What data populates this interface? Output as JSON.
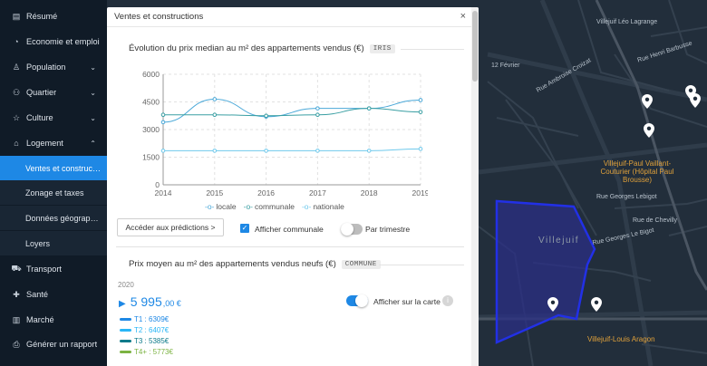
{
  "sidebar": {
    "items": [
      {
        "label": "Résumé",
        "icon": "document-icon",
        "glyph": "▤",
        "chevron": ""
      },
      {
        "label": "Economie et emploi",
        "icon": "pie-chart-icon",
        "glyph": "◔",
        "chevron": ""
      },
      {
        "label": "Population",
        "icon": "user-icon",
        "glyph": "♙",
        "chevron": "⌄"
      },
      {
        "label": "Quartier",
        "icon": "people-icon",
        "glyph": "⚇",
        "chevron": "⌄"
      },
      {
        "label": "Culture",
        "icon": "star-icon",
        "glyph": "☆",
        "chevron": "⌄"
      },
      {
        "label": "Logement",
        "icon": "home-icon",
        "glyph": "⌂",
        "chevron": "⌃"
      },
      {
        "label": "Transport",
        "icon": "car-icon",
        "glyph": "⛟",
        "chevron": ""
      },
      {
        "label": "Santé",
        "icon": "medical-icon",
        "glyph": "✚",
        "chevron": ""
      },
      {
        "label": "Marché",
        "icon": "bar-chart-icon",
        "glyph": "▥",
        "chevron": ""
      },
      {
        "label": "Générer un rapport",
        "icon": "printer-icon",
        "glyph": "⎙",
        "chevron": ""
      }
    ],
    "sub_items": [
      {
        "label": "Ventes et constructions",
        "active": true
      },
      {
        "label": "Zonage et taxes",
        "active": false
      },
      {
        "label": "Données géographiques",
        "active": false
      },
      {
        "label": "Loyers",
        "active": false
      }
    ]
  },
  "modal": {
    "title": "Ventes et constructions",
    "close": "×",
    "section1": {
      "title": "Évolution du prix median au m² des appartements vendus (€)",
      "tag": "IRIS"
    },
    "legend": [
      "locale",
      "communale",
      "nationale"
    ],
    "predictions_button": "Accéder aux prédictions  >",
    "checkbox_label": "Afficher communale",
    "checkbox_mark": "✓",
    "toggle_label": "Par trimestre",
    "section2": {
      "title": "Prix moyen au m² des appartements vendus neufs (€)",
      "tag": "COMMUNE"
    },
    "year": "2020",
    "price_main": "5 995",
    "price_dec": ",00 €",
    "map_toggle_label": "Afficher sur la carte",
    "info": "i",
    "types": [
      {
        "label": "T1 : 6309€",
        "color": "#1e88e5"
      },
      {
        "label": "T2 : 6407€",
        "color": "#29b6f6"
      },
      {
        "label": "T3 : 5385€",
        "color": "#0d7a8a"
      },
      {
        "label": "T4+ : 5773€",
        "color": "#7cb342"
      }
    ]
  },
  "chart_data": {
    "type": "line",
    "x": [
      2014,
      2015,
      2016,
      2017,
      2018,
      2019
    ],
    "series": [
      {
        "name": "locale",
        "values": [
          3400,
          4650,
          3700,
          4150,
          4150,
          4600
        ],
        "color": "#4aa8d8"
      },
      {
        "name": "communale",
        "values": [
          3800,
          3800,
          3750,
          3800,
          4150,
          3950
        ],
        "color": "#3a9fa3"
      },
      {
        "name": "nationale",
        "values": [
          1850,
          1850,
          1850,
          1850,
          1850,
          1950
        ],
        "color": "#6fc9ec"
      }
    ],
    "yticks": [
      0,
      1500,
      3000,
      4500,
      6000
    ],
    "ylim": [
      0,
      6000
    ],
    "grid": true
  },
  "map": {
    "labels": [
      {
        "text": "Villejuif Léo Lagrange"
      },
      {
        "text": "Rue Henri Barbusse"
      },
      {
        "text": "12 Février"
      },
      {
        "text": "Rue Ambroise Croizat"
      },
      {
        "text": "Rue Georges Lebigot"
      },
      {
        "text": "Rue de Chevilly"
      },
      {
        "text": "Villejuif"
      },
      {
        "text": "Villejuif-Paul Vaillant-Couturier (Hôpital Paul Brousse)"
      },
      {
        "text": "Villejuif-Louis Aragon"
      },
      {
        "text": "Rue Georges Le Bigot"
      }
    ]
  }
}
